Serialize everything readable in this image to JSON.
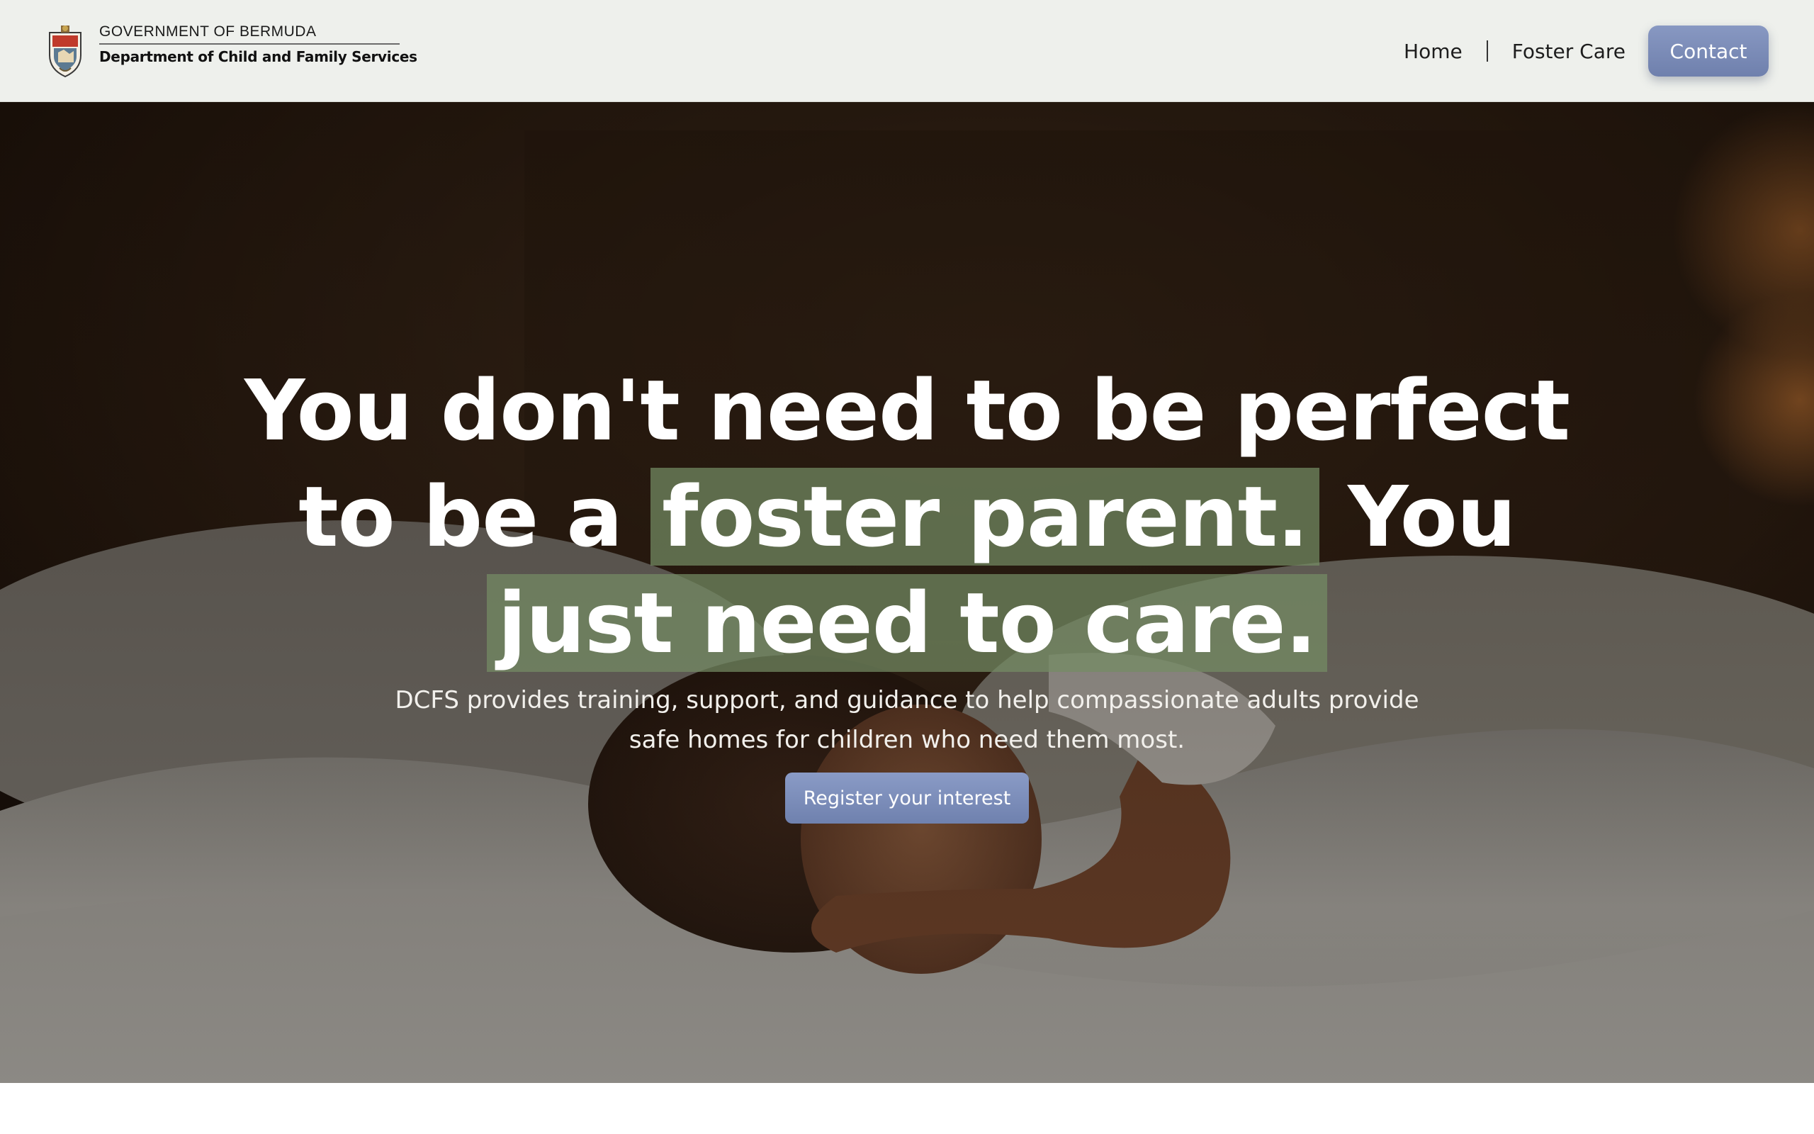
{
  "header": {
    "gov_label": "GOVERNMENT OF BERMUDA",
    "dept_label": "Department of Child and Family Services",
    "crest_icon": "bermuda-coat-of-arms-icon"
  },
  "nav": {
    "items": [
      {
        "label": "Home"
      },
      {
        "label": "Foster Care"
      }
    ],
    "contact_label": "Contact",
    "accent_color": "#7a8bb8"
  },
  "hero": {
    "headline_line1": "You don't need to be perfect",
    "headline_line2_pre": "to be a",
    "headline_line2_highlight": "foster parent.",
    "headline_line2_post": "You",
    "headline_line3_highlight": "just need to care.",
    "highlight_color": "#748c64",
    "subtext_line1": "DCFS provides training, support, and guidance to help compassionate adults provide",
    "subtext_line2": "safe homes for children who need them most.",
    "cta_label": "Register your interest"
  }
}
